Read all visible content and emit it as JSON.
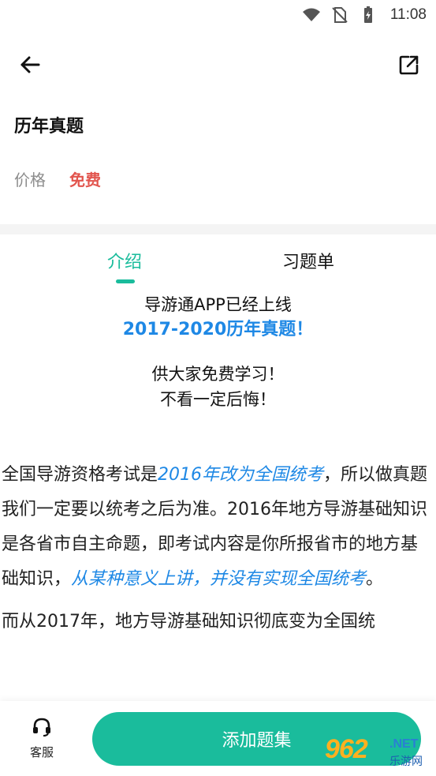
{
  "status_bar": {
    "time": "11:08"
  },
  "header": {
    "title": "历年真题"
  },
  "price": {
    "label": "价格",
    "value": "免费"
  },
  "tabs": [
    {
      "label": "介绍",
      "active": true
    },
    {
      "label": "习题单",
      "active": false
    }
  ],
  "intro": {
    "line1": "导游通APP已经上线",
    "highlight": "2017-2020历年真题！",
    "line3": "供大家免费学习！",
    "line4": "不看一定后悔！"
  },
  "body": {
    "p1_a": "全国导游资格考试是",
    "p1_em1": "2016年改为全国统考",
    "p1_b": "，所以做真题我们一定要以统考之后为准。2016年地方导游基础知识是各省市自主命题，即考试内容是你所报省市的地方基础知识，",
    "p1_em2": "从某种意义上讲，并没有实现全国统考",
    "p1_c": "。",
    "p2": "而从2017年，地方导游基础知识彻底变为全国统"
  },
  "bottom": {
    "service_label": "客服",
    "add_button": "添加题集"
  },
  "watermark": {
    "logo": "962",
    "net": ".NET",
    "sub": "乐游网"
  },
  "colors": {
    "accent": "#1abc9c",
    "price": "#e2554e",
    "highlight": "#1e88e5"
  },
  "icons": [
    "wifi-icon",
    "no-sim-icon",
    "battery-icon",
    "back-arrow-icon",
    "share-icon",
    "headset-icon"
  ]
}
